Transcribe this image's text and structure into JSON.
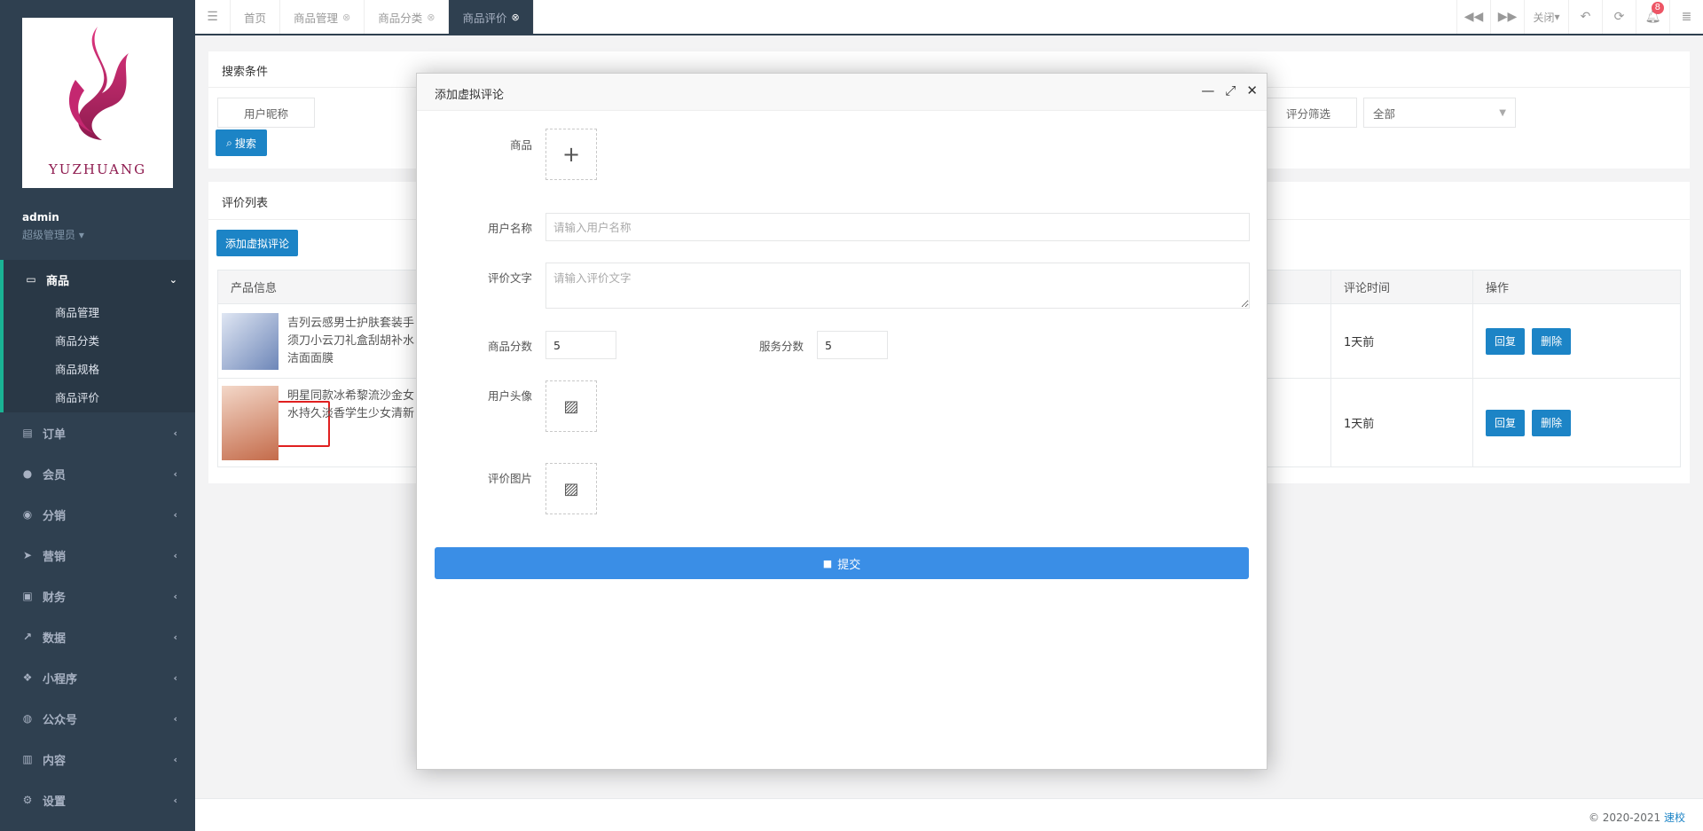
{
  "sidebar": {
    "logo_text": "YUZHUANG",
    "user_name": "admin",
    "user_role": "超级管理员",
    "menu": [
      {
        "label": "商品",
        "icon": "laptop-icon",
        "active": true,
        "children": [
          "商品管理",
          "商品分类",
          "商品规格",
          "商品评价"
        ]
      },
      {
        "label": "订单",
        "icon": "file-icon"
      },
      {
        "label": "会员",
        "icon": "user-icon"
      },
      {
        "label": "分销",
        "icon": "users-icon"
      },
      {
        "label": "营销",
        "icon": "paper-plane-icon"
      },
      {
        "label": "财务",
        "icon": "money-icon"
      },
      {
        "label": "数据",
        "icon": "line-chart-icon"
      },
      {
        "label": "小程序",
        "icon": "cubes-icon"
      },
      {
        "label": "公众号",
        "icon": "wechat-icon"
      },
      {
        "label": "内容",
        "icon": "book-icon"
      },
      {
        "label": "设置",
        "icon": "gear-icon"
      }
    ]
  },
  "topbar": {
    "tabs": [
      {
        "label": "首页",
        "closable": false
      },
      {
        "label": "商品管理",
        "closable": true
      },
      {
        "label": "商品分类",
        "closable": true
      },
      {
        "label": "商品评价",
        "closable": true,
        "active": true
      }
    ],
    "close_label": "关闭",
    "notification_count": "8"
  },
  "search": {
    "title": "搜索条件",
    "nickname_label": "用户昵称",
    "rating_label": "评分筛选",
    "rating_value": "全部",
    "search_button": "搜索"
  },
  "list": {
    "title": "评价列表",
    "add_button": "添加虚拟评论",
    "columns": {
      "product": "产品信息",
      "time": "评论时间",
      "action": "操作"
    },
    "rows": [
      {
        "product": "吉列云感男士护肤套装手动剃须刀小云刀礼盒刮胡补水洁面面膜",
        "line1": "吉列云感男士护肤套装手",
        "line2": "须刀小云刀礼盒刮胡补水",
        "line3": "洁面面膜",
        "time": "1天前"
      },
      {
        "product": "明星同款冰希黎流沙金女士香水持久淡香学生少女清新",
        "line1": "明星同款冰希黎流沙金女",
        "line2": "水持久淡香学生少女清新",
        "line3": "",
        "time": "1天前"
      }
    ],
    "reply_label": "回复",
    "delete_label": "删除"
  },
  "modal": {
    "title": "添加虚拟评论",
    "product_label": "商品",
    "username_label": "用户名称",
    "username_placeholder": "请输入用户名称",
    "comment_label": "评价文字",
    "comment_placeholder": "请输入评价文字",
    "product_score_label": "商品分数",
    "product_score": "5",
    "service_score_label": "服务分数",
    "service_score": "5",
    "avatar_label": "用户头像",
    "images_label": "评价图片",
    "submit_label": "提交"
  },
  "footer": {
    "copyright": "© 2020-2021 ",
    "link": "速校"
  }
}
